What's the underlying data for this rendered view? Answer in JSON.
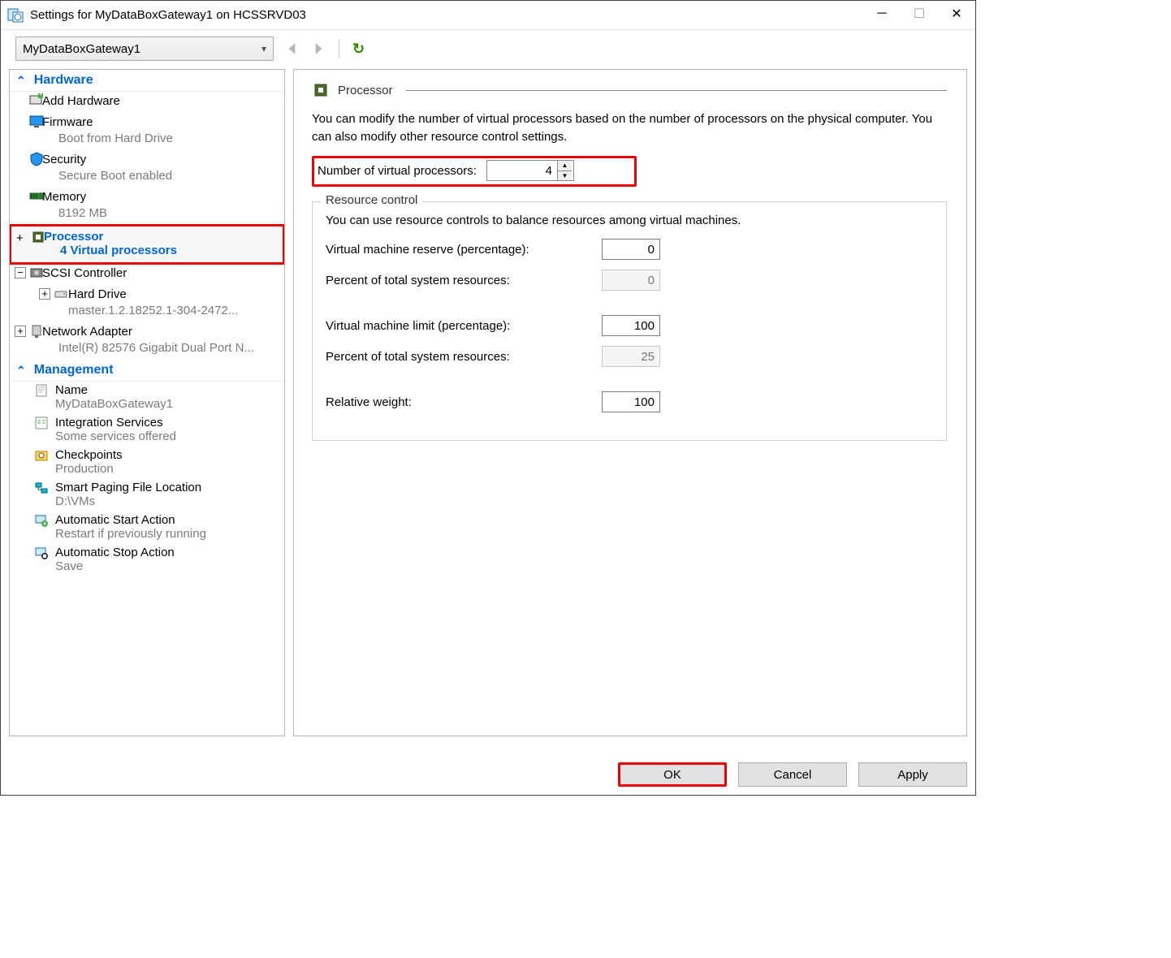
{
  "window": {
    "title": "Settings for MyDataBoxGateway1 on HCSSRVD03"
  },
  "vm_select": {
    "value": "MyDataBoxGateway1"
  },
  "sidebar": {
    "hardware_label": "Hardware",
    "management_label": "Management",
    "add_hw": "Add Hardware",
    "firmware": {
      "title": "Firmware",
      "sub": "Boot from Hard Drive"
    },
    "security": {
      "title": "Security",
      "sub": "Secure Boot enabled"
    },
    "memory": {
      "title": "Memory",
      "sub": "8192 MB"
    },
    "processor": {
      "title": "Processor",
      "sub": "4 Virtual processors"
    },
    "scsi": {
      "title": "SCSI Controller"
    },
    "harddrive": {
      "title": "Hard Drive",
      "sub": "master.1.2.18252.1-304-2472..."
    },
    "network": {
      "title": "Network Adapter",
      "sub": "Intel(R) 82576 Gigabit Dual Port N..."
    },
    "name": {
      "title": "Name",
      "sub": "MyDataBoxGateway1"
    },
    "integration": {
      "title": "Integration Services",
      "sub": "Some services offered"
    },
    "checkpoints": {
      "title": "Checkpoints",
      "sub": "Production"
    },
    "smartpaging": {
      "title": "Smart Paging File Location",
      "sub": "D:\\VMs"
    },
    "autostart": {
      "title": "Automatic Start Action",
      "sub": "Restart if previously running"
    },
    "autostop": {
      "title": "Automatic Stop Action",
      "sub": "Save"
    }
  },
  "panel": {
    "header": "Processor",
    "intro": "You can modify the number of virtual processors based on the number of processors on the physical computer. You can also modify other resource control settings.",
    "num_label": "Number of virtual processors:",
    "num_value": "4",
    "fieldset_legend": "Resource control",
    "fieldset_desc": "You can use resource controls to balance resources among virtual machines.",
    "reserve_label": "Virtual machine reserve (percentage):",
    "reserve_value": "0",
    "reserve_pct_label": "Percent of total system resources:",
    "reserve_pct_value": "0",
    "limit_label": "Virtual machine limit (percentage):",
    "limit_value": "100",
    "limit_pct_label": "Percent of total system resources:",
    "limit_pct_value": "25",
    "weight_label": "Relative weight:",
    "weight_value": "100"
  },
  "buttons": {
    "ok": "OK",
    "cancel": "Cancel",
    "apply": "Apply"
  }
}
